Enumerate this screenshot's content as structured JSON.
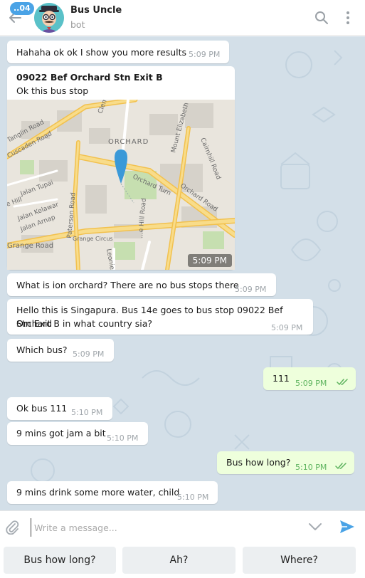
{
  "header": {
    "unread_count": "..04",
    "title": "Bus Uncle",
    "status": "bot"
  },
  "messages": [
    {
      "text": "Hahaha ok ok I show you more results",
      "time": "5:09 PM"
    },
    {
      "title": "09022 Bef Orchard Stn Exit B",
      "text": "Ok this bus stop",
      "time": "5:09 PM"
    },
    {
      "text": "What is ion orchard? There are no bus stops there",
      "time": "5:09 PM"
    },
    {
      "line1": "Hello this is Singapura. Bus 14e goes to bus stop 09022 Bef Orchard",
      "line2": "Stn Exit B in what country sia?",
      "time": "5:09 PM"
    },
    {
      "text": "Which bus?",
      "time": "5:09 PM"
    },
    {
      "text": "111",
      "time": "5:09 PM"
    },
    {
      "text": "Ok bus 111",
      "time": "5:10 PM"
    },
    {
      "text": "9 mins got jam a bit",
      "time": "5:10 PM"
    },
    {
      "text": "Bus how long?",
      "time": "5:10 PM"
    },
    {
      "text": "9 mins drink some more water, child",
      "time": "5:10 PM"
    }
  ],
  "map": {
    "labels": {
      "orchard": "ORCHARD",
      "tanglin": "Tanglin Road",
      "cuscaden": "Cuscaden Road",
      "clemenceau": "Clem...",
      "mount_elizabeth": "Mount Elizabeth",
      "cairnhill": "Cairnhill Road",
      "orchard_turn": "Orchard Turn",
      "orchard_road": "Orchard Road",
      "jalan_tupai": "Jalan Tupai",
      "hill": "e Hill",
      "jalan_kelawar": "Jalan Kelawar",
      "jalan_arnap": "Jalan Arnap",
      "paterson": "Paterson Road",
      "grange": "Grange Road",
      "grange_circus": "Grange Circus",
      "leonie": "Leonie Hi...",
      "hill_road": "...e Hill Road"
    }
  },
  "composer": {
    "placeholder": "Write a message..."
  },
  "keyboard": {
    "buttons": [
      "Bus how long?",
      "Ah?",
      "Where?"
    ]
  },
  "colors": {
    "accent": "#4aa3e6",
    "chat_background": "#d3dfe8",
    "outgoing_bubble": "#eeffdc",
    "read_check": "#5db35e"
  },
  "icons": {
    "back": "back-arrow-icon",
    "search": "search-icon",
    "more": "more-vertical-icon",
    "attach": "paperclip-icon",
    "chevron": "chevron-down-icon",
    "send": "send-icon",
    "check": "double-check-icon",
    "pin": "map-pin-icon"
  }
}
